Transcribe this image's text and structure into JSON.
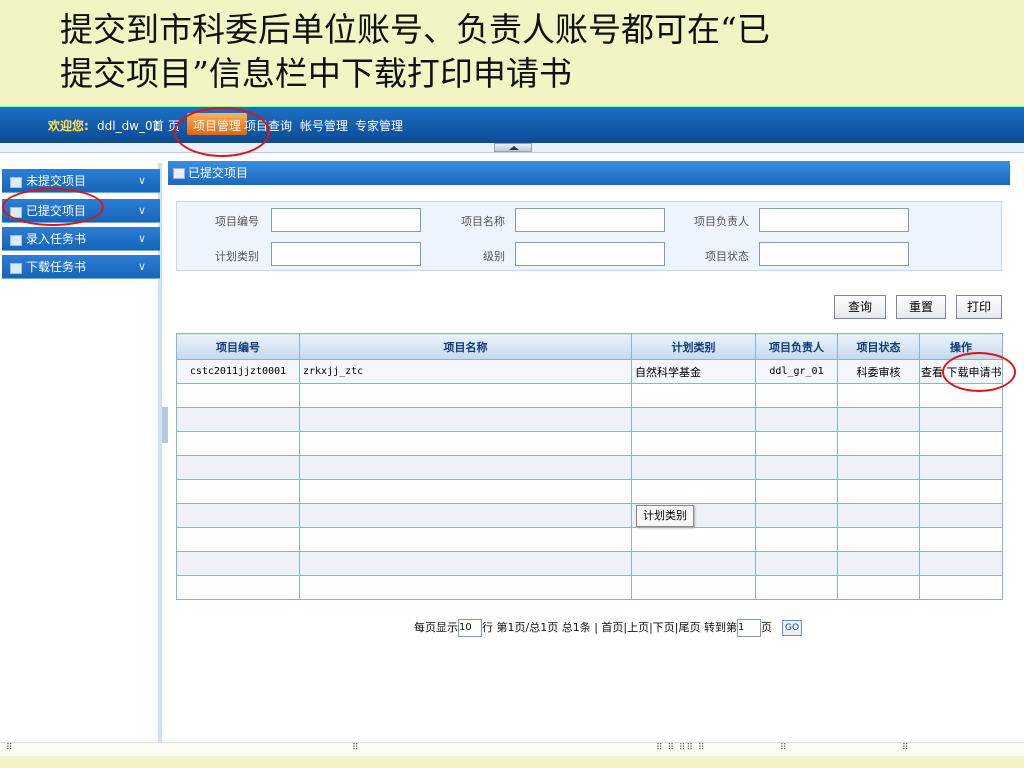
{
  "caption": {
    "line1": "提交到市科委后单位账号、负责人账号都可在“已",
    "line2": "提交项目”信息栏中下载打印申请书"
  },
  "topbar": {
    "welcome_label": "欢迎您:",
    "username": "ddl_dw_01",
    "nav": [
      "首 页",
      "项目管理",
      "项目查询",
      "帐号管理",
      "专家管理"
    ]
  },
  "sidebar": {
    "items": [
      {
        "label": "未提交项目"
      },
      {
        "label": "已提交项目"
      },
      {
        "label": "录入任务书"
      },
      {
        "label": "下载任务书"
      }
    ],
    "chevron": "∨"
  },
  "panel": {
    "title": "已提交项目"
  },
  "search": {
    "labels": [
      "项目编号",
      "项目名称",
      "项目负责人",
      "计划类别",
      "级别",
      "项目状态"
    ],
    "values": [
      "",
      "",
      "",
      "",
      "",
      ""
    ]
  },
  "buttons": {
    "query": "查询",
    "reset": "重置",
    "print": "打印"
  },
  "table": {
    "headers": [
      "项目编号",
      "项目名称",
      "计划类别",
      "项目负责人",
      "项目状态",
      "操作"
    ],
    "row1": {
      "code": "cstc2011jjzt0001",
      "name": "zrkxjj_ztc",
      "plan": "自然科学基金",
      "leader": "ddl_gr_01",
      "status": "科委审核",
      "view": "查看",
      "download": "下载申请书"
    }
  },
  "tooltip": "计划类别",
  "pager": {
    "per_page_prefix": "每页显示",
    "per_page_value": "10",
    "middle": "行 第1页/总1页 总1条 | 首页|上页|下页|尾页 转到第",
    "goto_value": "1",
    "page_suffix": "页",
    "go": "GO"
  },
  "colors": {
    "annotation": "#e01414",
    "nav_active": "#e0650f",
    "slide_bg": "#f2f4c4"
  }
}
